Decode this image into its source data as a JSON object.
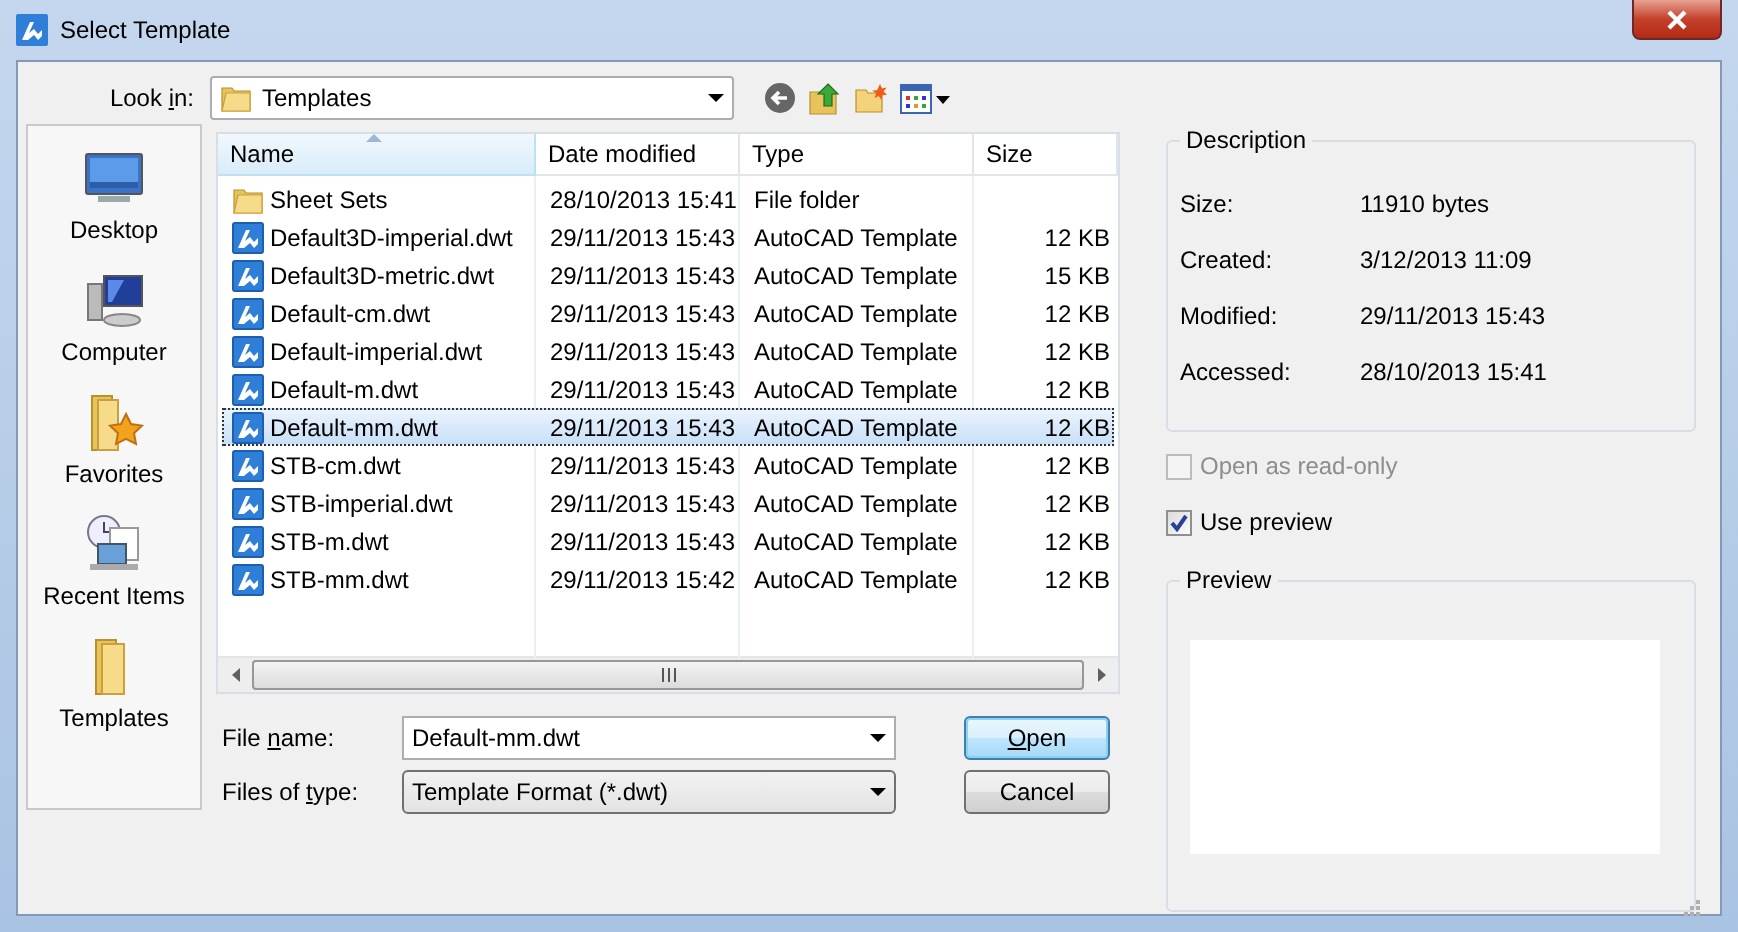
{
  "window": {
    "title": "Select Template"
  },
  "look_in": {
    "label": {
      "before": "Look ",
      "access_key": "i",
      "after": "n:"
    },
    "value": "Templates"
  },
  "places": [
    {
      "label": "Desktop",
      "kind": "desktop"
    },
    {
      "label": "Computer",
      "kind": "computer"
    },
    {
      "label": "Favorites",
      "kind": "favorites"
    },
    {
      "label": "Recent Items",
      "kind": "recent"
    },
    {
      "label": "Templates",
      "kind": "folder"
    }
  ],
  "table": {
    "columns": [
      {
        "label": "Name",
        "sorted": true
      },
      {
        "label": "Date modified",
        "sorted": false
      },
      {
        "label": "Type",
        "sorted": false
      },
      {
        "label": "Size",
        "sorted": false
      }
    ],
    "rows": [
      {
        "kind": "folder",
        "name": "Sheet Sets",
        "date": "28/10/2013 15:41",
        "type": "File folder",
        "selected": false
      },
      {
        "kind": "template",
        "name": "Default3D-imperial.dwt",
        "date": "29/11/2013 15:43",
        "type": "AutoCAD Template",
        "size": "12 KB",
        "selected": false
      },
      {
        "kind": "template",
        "name": "Default3D-metric.dwt",
        "date": "29/11/2013 15:43",
        "type": "AutoCAD Template",
        "size": "15 KB",
        "selected": false
      },
      {
        "kind": "template",
        "name": "Default-cm.dwt",
        "date": "29/11/2013 15:43",
        "type": "AutoCAD Template",
        "size": "12 KB",
        "selected": false
      },
      {
        "kind": "template",
        "name": "Default-imperial.dwt",
        "date": "29/11/2013 15:43",
        "type": "AutoCAD Template",
        "size": "12 KB",
        "selected": false
      },
      {
        "kind": "template",
        "name": "Default-m.dwt",
        "date": "29/11/2013 15:43",
        "type": "AutoCAD Template",
        "size": "12 KB",
        "selected": false
      },
      {
        "kind": "template",
        "name": "Default-mm.dwt",
        "date": "29/11/2013 15:43",
        "type": "AutoCAD Template",
        "size": "12 KB",
        "selected": true
      },
      {
        "kind": "template",
        "name": "STB-cm.dwt",
        "date": "29/11/2013 15:43",
        "type": "AutoCAD Template",
        "size": "12 KB",
        "selected": false
      },
      {
        "kind": "template",
        "name": "STB-imperial.dwt",
        "date": "29/11/2013 15:43",
        "type": "AutoCAD Template",
        "size": "12 KB",
        "selected": false
      },
      {
        "kind": "template",
        "name": "STB-m.dwt",
        "date": "29/11/2013 15:43",
        "type": "AutoCAD Template",
        "size": "12 KB",
        "selected": false
      },
      {
        "kind": "template",
        "name": "STB-mm.dwt",
        "date": "29/11/2013 15:42",
        "type": "AutoCAD Template",
        "size": "12 KB",
        "selected": false
      }
    ]
  },
  "file_name": {
    "label": {
      "before": "File ",
      "access_key": "n",
      "after": "ame:"
    },
    "value": "Default-mm.dwt"
  },
  "file_type": {
    "label": {
      "before": "Files of ",
      "access_key": "t",
      "after": "ype:"
    },
    "value": "Template Format (*.dwt)"
  },
  "buttons": [
    {
      "label": {
        "access_key": "O",
        "after": "pen"
      },
      "default": true
    },
    {
      "label": "Cancel",
      "default": false
    }
  ],
  "description": {
    "title": "Description",
    "fields": [
      {
        "label": "Size:",
        "value": "11910 bytes"
      },
      {
        "label": "Created:",
        "value": "3/12/2013 11:09"
      },
      {
        "label": "Modified:",
        "value": "29/11/2013 15:43"
      },
      {
        "label": "Accessed:",
        "value": "28/10/2013 15:41"
      }
    ]
  },
  "options": [
    {
      "label": "Open as read-only",
      "checked": false,
      "disabled": true
    },
    {
      "label": "Use preview",
      "checked": true,
      "disabled": false
    }
  ],
  "preview": {
    "title": "Preview"
  }
}
